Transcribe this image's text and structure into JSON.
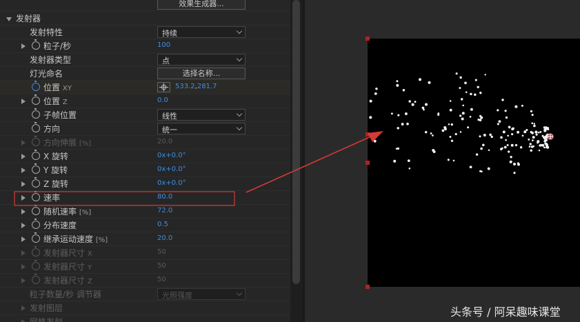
{
  "top_button": "效果生成器...",
  "section": {
    "label": "发射器"
  },
  "rows": [
    {
      "label": "发射特性",
      "dropdown": "持续"
    },
    {
      "label": "粒子/秒",
      "value": "100"
    },
    {
      "label": "发射器类型",
      "dropdown": "点"
    },
    {
      "label": "灯光命名",
      "button": "选择名称..."
    },
    {
      "label": "位置",
      "unit": "XY",
      "value_x": "533.2",
      "sep": ",",
      "value_y": "281.7"
    },
    {
      "label": "位置",
      "unit": "Z",
      "value": "0.0"
    },
    {
      "label": "子帧位置",
      "dropdown": "线性"
    },
    {
      "label": "方向",
      "dropdown": "统一"
    },
    {
      "label": "方向伸展",
      "unit": "[%]",
      "value": "20.0"
    },
    {
      "label": "X 旋转",
      "value": "0x+0.0°"
    },
    {
      "label": "Y 旋转",
      "value": "0x+0.0°"
    },
    {
      "label": "Z 旋转",
      "value": "0x+0.0°"
    },
    {
      "label": "速率",
      "value": "80.0"
    },
    {
      "label": "随机速率",
      "unit": "[%]",
      "value": "72.0"
    },
    {
      "label": "分布速度",
      "value": "0.5"
    },
    {
      "label": "继承运动速度",
      "unit": "[%]",
      "value": "20.0"
    },
    {
      "label": "发射器尺寸",
      "unit": "X",
      "value": "50"
    },
    {
      "label": "发射器尺寸",
      "unit": "Y",
      "value": "50"
    },
    {
      "label": "发射器尺寸",
      "unit": "Z",
      "value": "50"
    },
    {
      "label": "粒子数量/秒 调节器",
      "dropdown": "光照强度"
    },
    {
      "label": "发射图层"
    },
    {
      "label": "网格发射"
    }
  ],
  "watermark": "头条号 / 阿呆趣味课堂",
  "colors": {
    "value_blue": "#3f8fe0",
    "highlight_box": "#d53a36",
    "arrow": "#d53a36",
    "handle": "#b62020"
  }
}
